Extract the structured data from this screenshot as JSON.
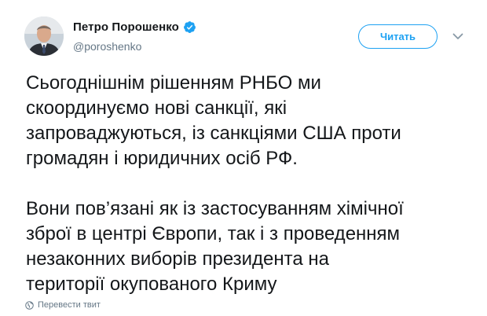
{
  "author": {
    "display_name": "Петро Порошенко",
    "handle": "@poroshenko",
    "verified": true,
    "avatar_icon": "profile-photo"
  },
  "actions": {
    "follow_label": "Читать",
    "more_icon": "chevron-down-icon"
  },
  "tweet": {
    "paragraphs": [
      "Сьогоднішнім рішенням РНБО ми\nскоординуємо нові санкції, які\nзапроваджуються, із санкціями США проти\nгромадян і юридичних осіб РФ.",
      "Вони пов’язані як із застосуванням хімічної\nзброї в центрі Європи, так і з проведенням\nнезаконних виборів президента на\nтериторії окупованого Криму"
    ]
  },
  "translate": {
    "label": "Перевести твит",
    "icon": "globe-icon"
  },
  "colors": {
    "accent": "#1da1f2",
    "text": "#14171a",
    "muted": "#657786"
  }
}
